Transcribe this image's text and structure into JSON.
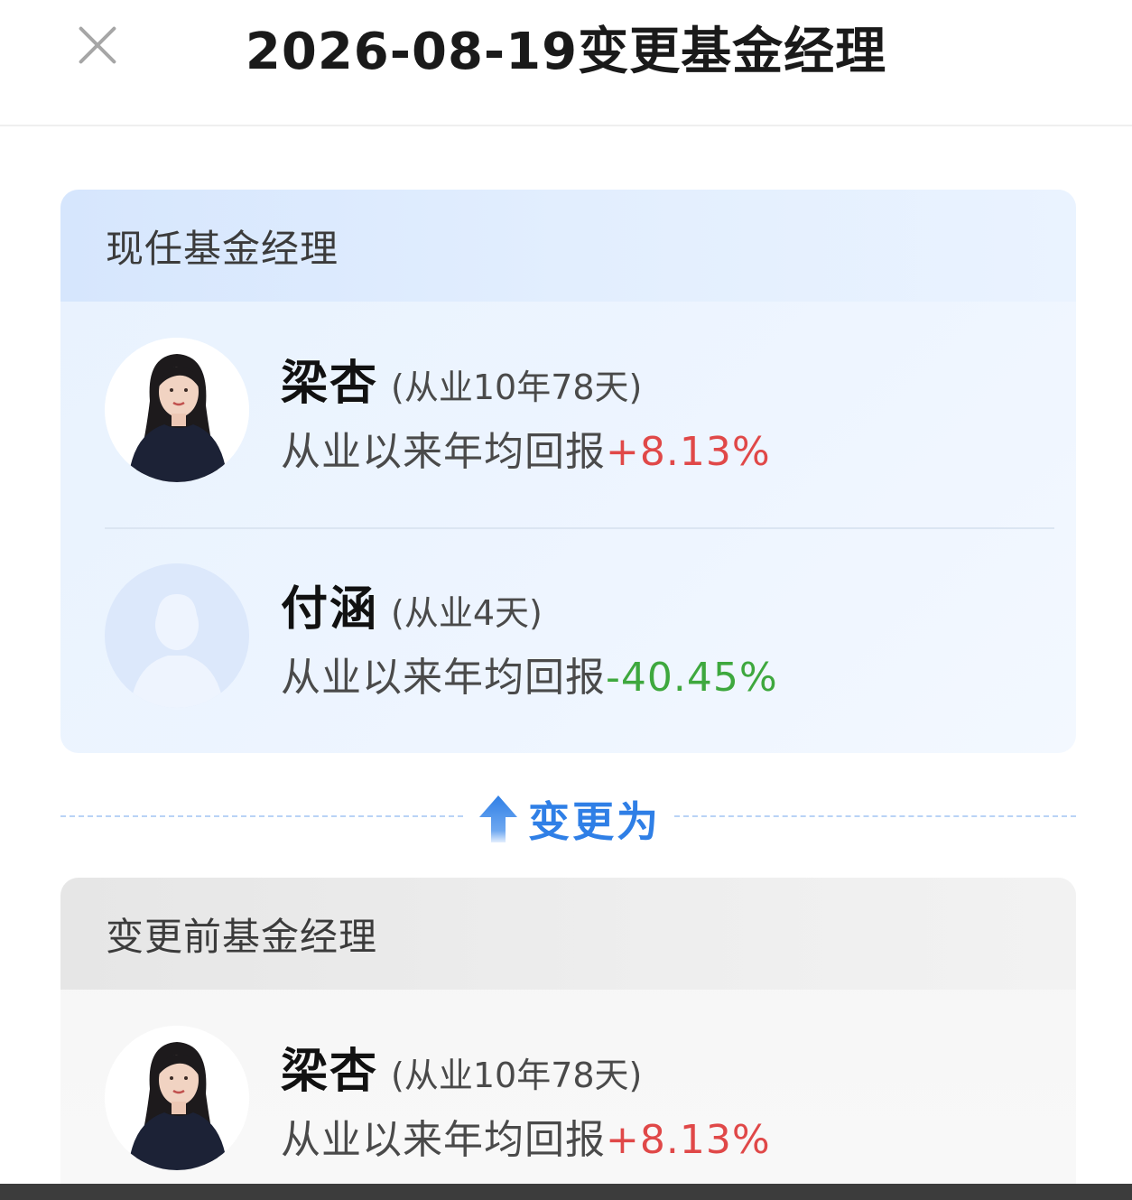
{
  "header": {
    "title": "2026-08-19变更基金经理"
  },
  "current_section": {
    "title": "现任基金经理",
    "managers": [
      {
        "name": "梁杏",
        "tenure": "(从业10年78天)",
        "return_label": "从业以来年均回报",
        "return_value": "+8.13%",
        "trend": "positive",
        "avatar": "photo-avatar-icon"
      },
      {
        "name": "付涵",
        "tenure": "(从业4天)",
        "return_label": "从业以来年均回报",
        "return_value": "-40.45%",
        "trend": "negative",
        "avatar": "placeholder-avatar-icon"
      }
    ]
  },
  "change": {
    "label": "变更为",
    "icon": "arrow-up-icon"
  },
  "previous_section": {
    "title": "变更前基金经理",
    "managers": [
      {
        "name": "梁杏",
        "tenure": "(从业10年78天)",
        "return_label": "从业以来年均回报",
        "return_value": "+8.13%",
        "trend": "positive",
        "avatar": "photo-avatar-icon"
      }
    ]
  },
  "colors": {
    "positive": "#e04848",
    "negative": "#3ea83e",
    "accent": "#2f7fe6",
    "current_card_bg": "#e8f2fe",
    "previous_card_bg": "#f6f6f6"
  }
}
